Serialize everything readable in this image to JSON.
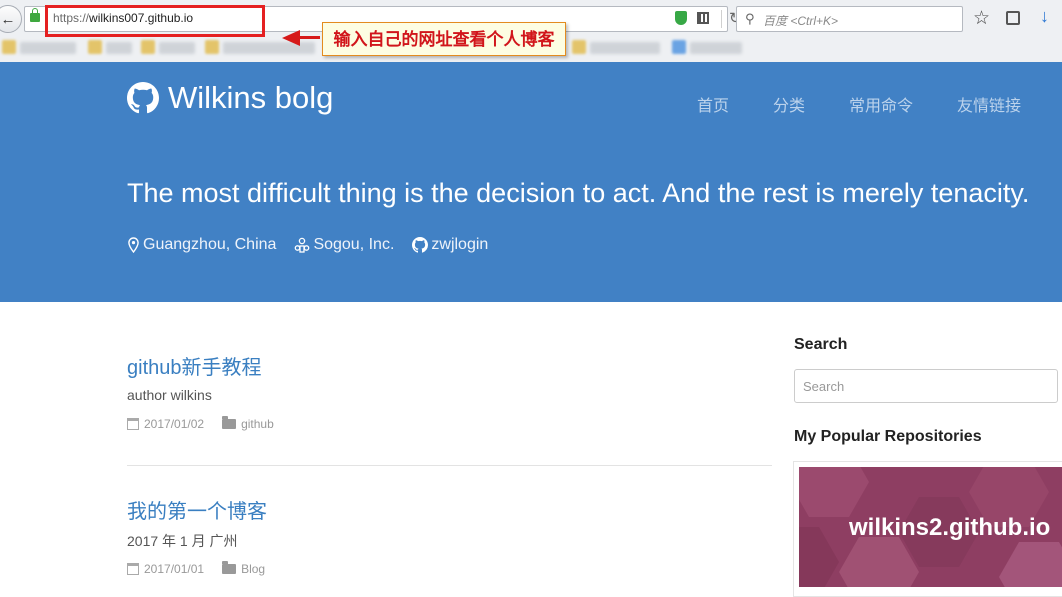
{
  "browser": {
    "url_scheme": "https://",
    "url_host": "wilkins007.github.io",
    "search_placeholder": "百度 <Ctrl+K>",
    "annotation": "输入自己的网址查看个人博客"
  },
  "header": {
    "brand": "Wilkins bolg",
    "nav": [
      "首页",
      "分类",
      "常用命令",
      "友情链接"
    ],
    "tagline": "The most difficult thing is the decision to act. And the rest is merely tenacity.",
    "location": "Guangzhou, China",
    "company": "Sogou, Inc.",
    "github_user": "zwjlogin"
  },
  "posts": [
    {
      "title": "github新手教程",
      "subtitle": "author wilkins",
      "date": "2017/01/02",
      "category": "github"
    },
    {
      "title": "我的第一个博客",
      "subtitle": "2017 年 1 月 广州",
      "date": "2017/01/01",
      "category": "Blog"
    }
  ],
  "sidebar": {
    "search_heading": "Search",
    "search_placeholder": "Search",
    "repos_heading": "My Popular Repositories",
    "repo_name": "wilkins2.github.io"
  },
  "colors": {
    "header_bg": "#4181c5",
    "link": "#3a7fc1",
    "annotation_red": "#d1151b",
    "repo_card": "#8e3e62"
  }
}
